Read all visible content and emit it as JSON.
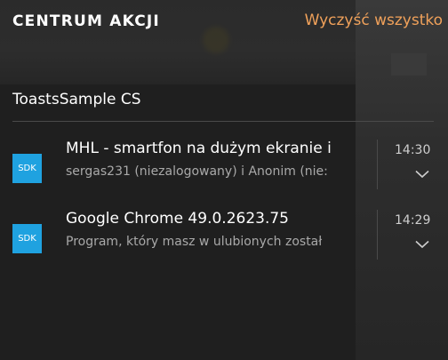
{
  "header": {
    "title": "CENTRUM AKCJI",
    "clear_all": "Wyczyść wszystko"
  },
  "group": {
    "app_name": "ToastsSample CS"
  },
  "notifications": [
    {
      "icon_label": "SDK",
      "title": "MHL - smartfon na dużym ekranie i",
      "body": "sergas231 (niezalogowany) i Anonim (nie:",
      "time": "14:30"
    },
    {
      "icon_label": "SDK",
      "title": "Google Chrome 49.0.2623.75",
      "body": "Program, który masz w ulubionych został",
      "time": "14:29"
    }
  ],
  "colors": {
    "accent": "#f0a15a",
    "app_icon": "#1fa2e0",
    "panel_background": "#1f1f1f"
  }
}
